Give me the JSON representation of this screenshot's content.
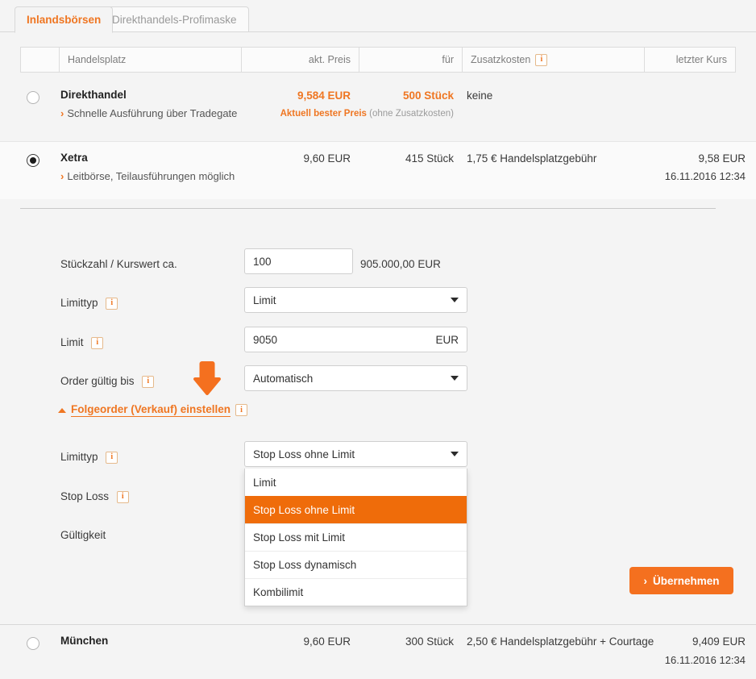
{
  "tabs": [
    {
      "label": "Inlandsbörsen",
      "active": true
    },
    {
      "label": "Direkthandels-Profimaske",
      "active": false
    }
  ],
  "table": {
    "headers": {
      "handelsplatz": "Handelsplatz",
      "akt_preis": "akt. Preis",
      "fuer": "für",
      "zusatzkosten": "Zusatzkosten",
      "zusatzkosten_info_icon": "info-icon",
      "letzter_kurs": "letzter Kurs"
    },
    "rows": [
      {
        "name": "Direkthandel",
        "sub": "Schnelle Ausführung über Tradegate",
        "price": "9,584 EUR",
        "qty": "500 Stück",
        "zusatzkosten": "keine",
        "best_label": "Aktuell bester Preis",
        "best_note": "(ohne Zusatzkosten)",
        "last": "",
        "last_time": "",
        "selected": false
      },
      {
        "name": "Xetra",
        "sub": "Leitbörse, Teilausführungen möglich",
        "price": "9,60 EUR",
        "qty": "415 Stück",
        "zusatzkosten": "1,75 € Handelsplatzgebühr",
        "best_label": "",
        "best_note": "",
        "last": "9,58 EUR",
        "last_time": "16.11.2016 12:34",
        "selected": true
      },
      {
        "name": "München",
        "sub": "",
        "price": "9,60 EUR",
        "qty": "300 Stück",
        "zusatzkosten": "2,50 € Handelsplatzgebühr + Courtage",
        "best_label": "",
        "best_note": "",
        "last": "9,409 EUR",
        "last_time": "16.11.2016 12:34",
        "selected": false
      }
    ]
  },
  "form": {
    "stueckzahl_label": "Stückzahl / Kurswert ca.",
    "stueckzahl_value": "100",
    "kurswert_value": "905.000,00 EUR",
    "limittyp_label": "Limittyp",
    "limittyp_value": "Limit",
    "limit_label": "Limit",
    "limit_value": "9050",
    "limit_suffix": "EUR",
    "gueltig_label": "Order gültig bis",
    "gueltig_value": "Automatisch",
    "info_icon": "info-icon",
    "arrow_icon": "down-arrow-icon"
  },
  "folgeorder": {
    "toggle_label": "Folgeorder (Verkauf) einstellen",
    "caret_icon": "chevron-up-icon",
    "info_icon": "info-icon",
    "limittyp_label": "Limittyp",
    "limittyp_value": "Stop Loss ohne Limit",
    "stoploss_label": "Stop Loss",
    "gueltigkeit_label": "Gültigkeit",
    "options": [
      {
        "label": "Limit",
        "selected": false
      },
      {
        "label": "Stop Loss ohne Limit",
        "selected": true
      },
      {
        "label": "Stop Loss mit Limit",
        "selected": false
      },
      {
        "label": "Stop Loss dynamisch",
        "selected": false
      },
      {
        "label": "Kombilimit",
        "selected": false
      }
    ]
  },
  "submit": {
    "label": "Übernehmen",
    "chevron": "›"
  },
  "colors": {
    "accent": "#ef7622",
    "highlight": "#ef6c0a",
    "button": "#f4701f",
    "page_bg": "#f4f4f4"
  }
}
